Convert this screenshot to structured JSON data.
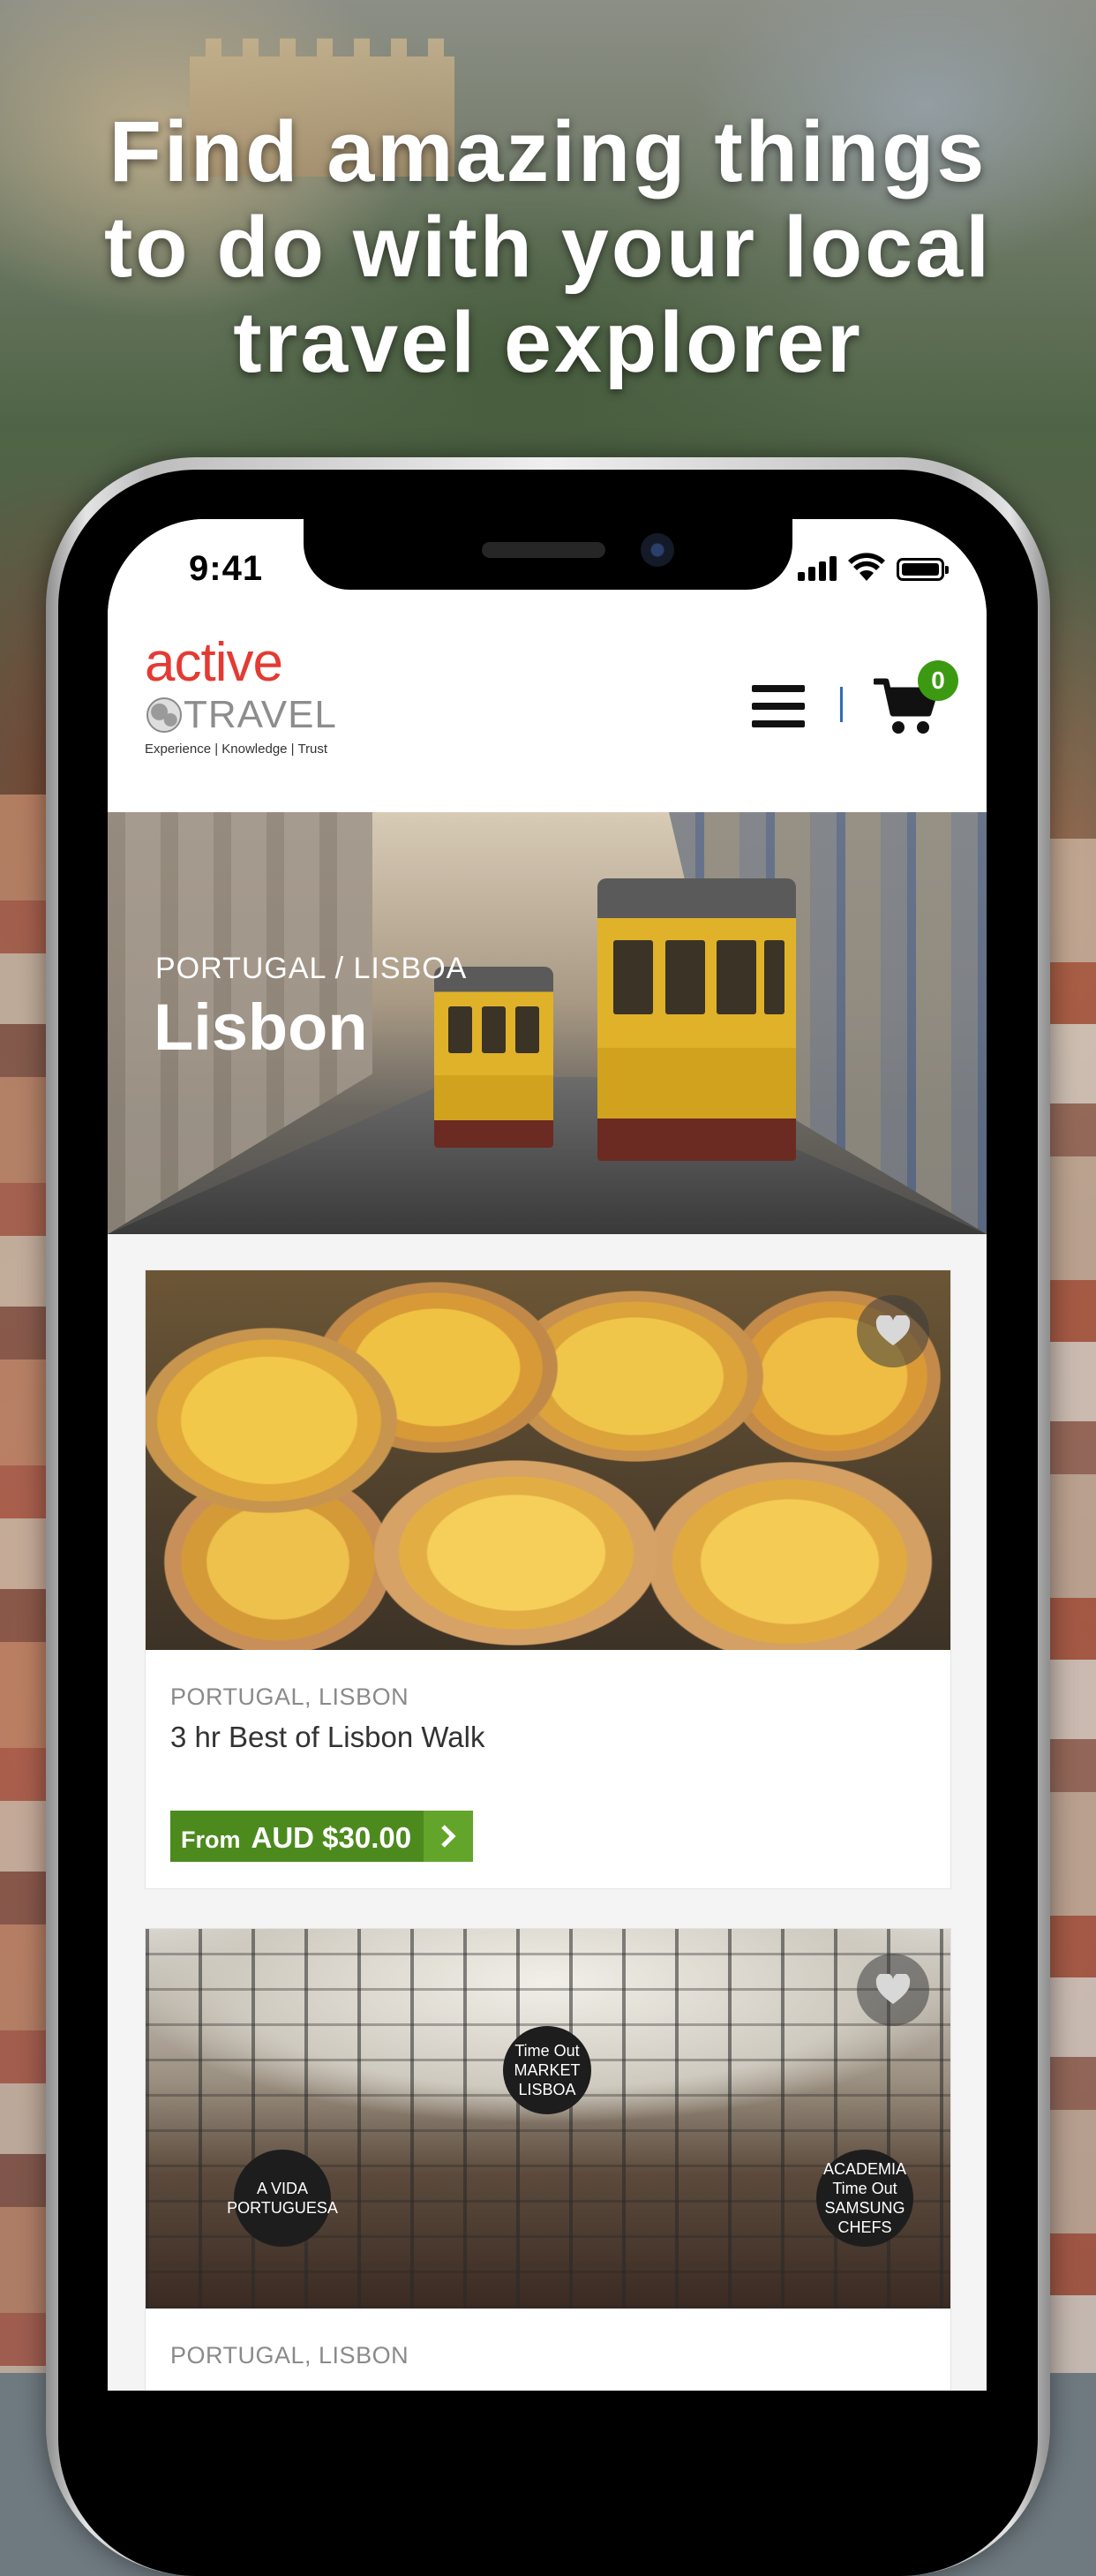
{
  "headline": "Find amazing things\nto do with your local\ntravel explorer",
  "status_bar": {
    "time": "9:41"
  },
  "logo": {
    "word1": "active",
    "word2": "TRAVEL",
    "tagline": "Experience | Knowledge | Trust"
  },
  "header": {
    "cart_count": "0"
  },
  "hero": {
    "breadcrumb": "PORTUGAL / LISBOA",
    "title": "Lisbon"
  },
  "cards": [
    {
      "location": "PORTUGAL, LISBON",
      "title": "3 hr Best of Lisbon Walk",
      "price_prefix": "From",
      "price": "AUD $30.00"
    },
    {
      "location": "PORTUGAL, LISBON",
      "sign_left": "A VIDA PORTUGUESA",
      "sign_center": "Time Out MARKET LISBOA",
      "sign_right": "ACADEMIA Time Out SAMSUNG CHEFS"
    }
  ],
  "colors": {
    "brand_red": "#e43a33",
    "price_green": "#4c8a1e",
    "badge_green": "#3c9a12"
  },
  "icons": [
    "signal-icon",
    "wifi-icon",
    "battery-icon",
    "menu-icon",
    "cart-icon",
    "heart-icon",
    "chevron-right-icon"
  ]
}
